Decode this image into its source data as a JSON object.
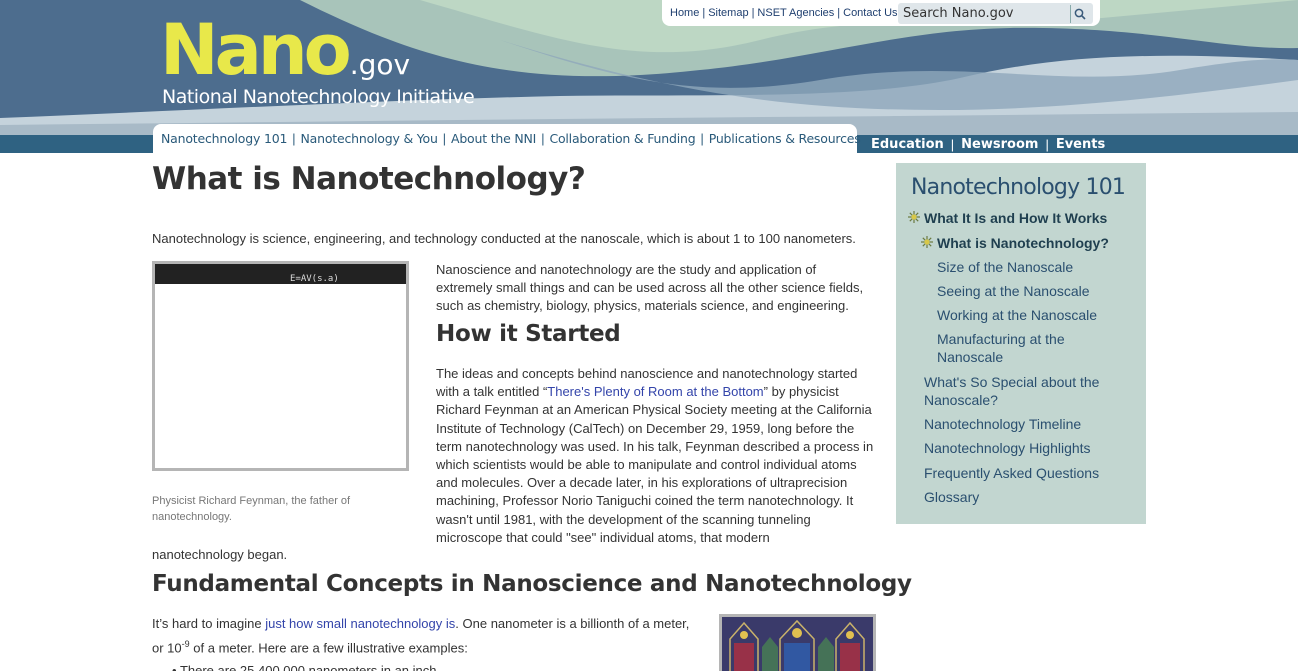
{
  "header": {
    "logo_main": "Nano",
    "logo_suffix": ".gov",
    "logo_subtitle": "National Nanotechnology Initiative"
  },
  "utility_links": [
    "Home",
    "Sitemap",
    "NSET Agencies",
    "Contact Us"
  ],
  "search": {
    "placeholder": "Search Nano.gov"
  },
  "nav_main": [
    "Nanotechnology 101",
    "Nanotechnology & You",
    "About the NNI",
    "Collaboration & Funding",
    "Publications & Resources"
  ],
  "nav_secondary": [
    "Education",
    "Newsroom",
    "Events"
  ],
  "colors": {
    "logo": "#e8e84a",
    "nav_strip": "#2f6282",
    "sidebar_bg": "#c2d6d0",
    "link": "#3344aa"
  },
  "main": {
    "title": "What is Nanotechnology?",
    "intro": "Nanotechnology is science, engineering, and technology conducted at the nanoscale, which is about 1 to 100 nanometers.",
    "photo_caption": "Physicist Richard Feynman, the father of nanotechnology.",
    "photo_board_text": "E=AV(s.a)",
    "p1": "Nanoscience and nanotechnology are the study and application of extremely small things and can be used across all the other science fields, such as chemistry, biology, physics, materials science, and engineering.",
    "how_started_heading": "How it Started",
    "p2_before": "The ideas and concepts behind nanoscience and nanotechnology started with a talk entitled “",
    "p2_link": "There's Plenty of Room at the Bottom",
    "p2_after": "” by physicist Richard Feynman at an American Physical Society meeting at the California Institute of Technology (CalTech) on December 29, 1959, long before the term nanotechnology was used. In his talk, Feynman described a process in which scientists would be able to manipulate and control individual atoms and molecules. Over a decade later, in his explorations of ultraprecision machining, Professor Norio Taniguchi coined the term nanotechnology. It wasn't until 1981, with the development of the scanning tunneling microscope that could \"see\" individual atoms, that modern",
    "p2_end": "nanotechnology began.",
    "fundamental_heading": "Fundamental Concepts in Nanoscience and Nanotechnology",
    "p4_before": "It’s hard to imagine ",
    "p4_link": "just how small nanotechnology is",
    "p4_after": ". One nanometer is a billionth of a meter, or 10",
    "p4_sup": "-9",
    "p4_end": " of a meter. Here are a few illustrative examples:",
    "bullet_1": "There are 25,400,000 nanometers in an inch"
  },
  "sidebar": {
    "title": "Nanotechnology 101",
    "items": [
      "What It Is and How It Works",
      "What is Nanotechnology?",
      "Size of the Nanoscale",
      "Seeing at the Nanoscale",
      "Working at the Nanoscale",
      "Manufacturing at the Nanoscale",
      "What's So Special about the Nanoscale?",
      "Nanotechnology Timeline",
      "Nanotechnology Highlights",
      "Frequently Asked Questions",
      "Glossary"
    ]
  }
}
